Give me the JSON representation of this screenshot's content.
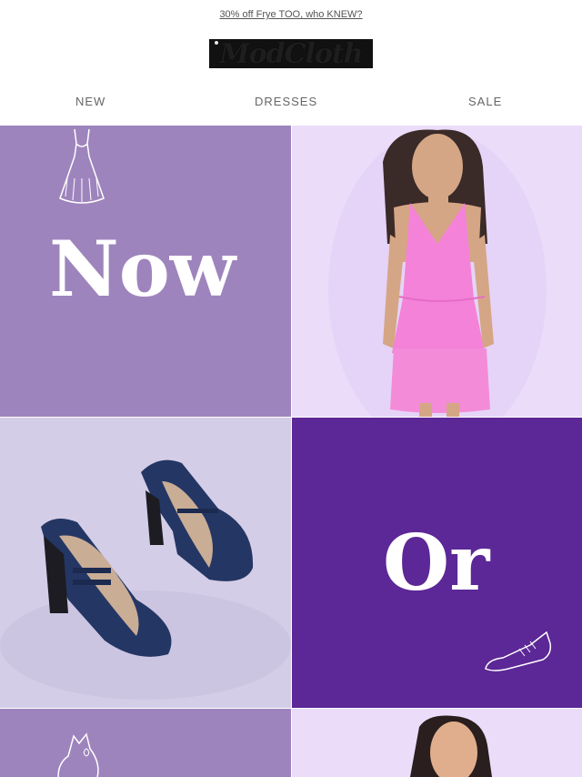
{
  "promo": {
    "text": "30% off Frye TOO, who KNEW?"
  },
  "brand": {
    "name": "ModCloth"
  },
  "nav": {
    "items": [
      "NEW",
      "DRESSES",
      "SALE"
    ]
  },
  "tiles": {
    "now_word": "Now",
    "or_word": "Or",
    "colors": {
      "lavender": "#9e84bd",
      "light_lavender": "#ebdcfa",
      "periwinkle": "#d4cde7",
      "purple": "#5c2796",
      "pink": "#f482d8",
      "navy": "#243664"
    }
  }
}
